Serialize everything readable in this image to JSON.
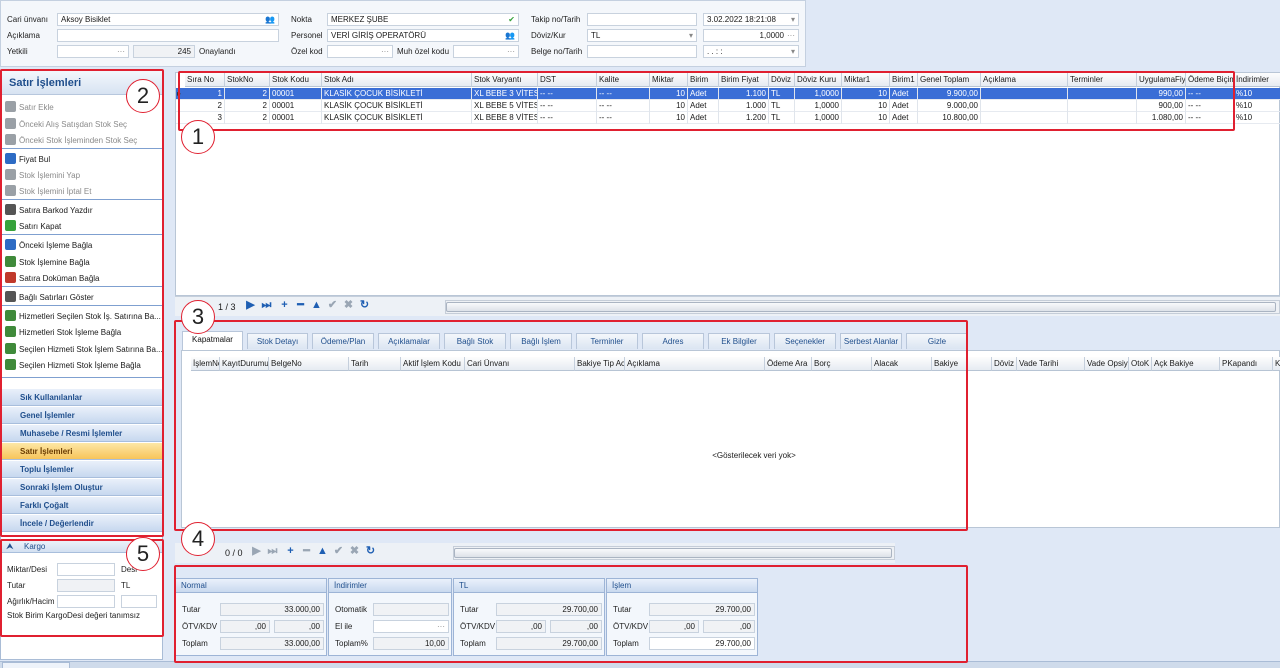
{
  "header": {
    "cari_unvani_label": "Cari ünvanı",
    "cari_unvani_value": "Aksoy Bisiklet",
    "aciklama_label": "Açıklama",
    "yetkili_label": "Yetkili",
    "yetkili_num": "245",
    "yetkili_status": "Onaylandı",
    "nokta_label": "Nokta",
    "nokta_value": "MERKEZ ŞUBE",
    "personel_label": "Personel",
    "personel_value": "VERİ GİRİŞ OPERATÖRÜ",
    "ozel_kod_label": "Özel kod",
    "muh_ozel_kodu_label": "Muh özel kodu",
    "takip_label": "Takip no/Tarih",
    "takip_date": "3.02.2022 18:21:08",
    "doviz_label": "Döviz/Kur",
    "doviz_value": "TL",
    "kur_value": "1,0000",
    "belge_label": "Belge no/Tarih",
    "belge_date": ". .  : :"
  },
  "left": {
    "title": "Satır İşlemleri",
    "items": [
      {
        "label": "Satır Ekle",
        "icon": "plus-icon",
        "color": "#9aa0a6"
      },
      {
        "label": "Önceki Alış Satışdan Stok Seç",
        "icon": "undo-icon",
        "color": "#9aa0a6"
      },
      {
        "label": "Önceki Stok İşleminden Stok Seç",
        "icon": "undo-icon",
        "color": "#9aa0a6"
      },
      {
        "label": "Fiyat Bul",
        "icon": "tag-icon",
        "color": "#2d6bc4"
      },
      {
        "label": "Stok İşlemini Yap",
        "icon": "redo-icon",
        "color": "#9aa0a6"
      },
      {
        "label": "Stok İşlemini İptal Et",
        "icon": "undo-icon",
        "color": "#9aa0a6"
      },
      {
        "label": "Satıra Barkod Yazdır",
        "icon": "barcode-icon",
        "color": "#555"
      },
      {
        "label": "Satırı Kapat",
        "icon": "check-circle-icon",
        "color": "#36a23b"
      },
      {
        "label": "Önceki İşleme Bağla",
        "icon": "eye-icon",
        "color": "#2d6bc4"
      },
      {
        "label": "Stok İşlemine Bağla",
        "icon": "gear-icon",
        "color": "#3f8a3a"
      },
      {
        "label": "Satıra Doküman Bağla",
        "icon": "document-icon",
        "color": "#c0392b"
      },
      {
        "label": "Bağlı Satırları Göster",
        "icon": "list-icon",
        "color": "#555"
      },
      {
        "label": "Hizmetleri Seçilen Stok İş. Satırına Ba...",
        "icon": "gear-icon",
        "color": "#3f8a3a"
      },
      {
        "label": "Hizmetleri Stok İşleme Bağla",
        "icon": "gear-icon",
        "color": "#3f8a3a"
      },
      {
        "label": "Seçilen Hizmeti Stok İşlem Satırına Ba...",
        "icon": "gear-icon",
        "color": "#3f8a3a"
      },
      {
        "label": "Seçilen Hizmeti Stok İşleme Bağla",
        "icon": "gear-icon",
        "color": "#3f8a3a"
      }
    ],
    "groups": [
      "Sık Kullanılanlar",
      "Genel İşlemler",
      "Muhasebe / Resmi İşlemler",
      "Satır İşlemleri",
      "Toplu İşlemler",
      "Sonraki İşlem Oluştur",
      "Farklı Çoğalt",
      "İncele / Değerlendir"
    ],
    "kargo": {
      "title": "Kargo",
      "miktar_label": "Miktar/Desi",
      "desi_label": "Desi",
      "tutar_label": "Tutar",
      "tutar_currency": "TL",
      "agirlik_label": "Ağırlık/Hacim",
      "note": "Stok Birim KargoDesi değeri tanımsız"
    }
  },
  "grid": {
    "columns": [
      "Sıra No",
      "StokNo",
      "Stok Kodu",
      "Stok Adı",
      "Stok Varyantı",
      "DST",
      "Kalite",
      "Miktar",
      "Birim",
      "Birim Fiyat",
      "Döviz",
      "Döviz Kuru",
      "Miktar1",
      "Birim1",
      "Genel Toplam",
      "Açıklama",
      "Terminler",
      "UygulamaFiy",
      "Ödeme Biçim",
      "İndirimler"
    ],
    "rows": [
      [
        "1",
        "2",
        "00001",
        "KLASİK ÇOCUK BİSİKLETİ",
        "XL BEBE 3 VİTES",
        "-- --",
        "-- --",
        "10",
        "Adet",
        "1.100",
        "TL",
        "1,0000",
        "10",
        "Adet",
        "9.900,00",
        "",
        "",
        "990,00",
        "-- --",
        "%10"
      ],
      [
        "2",
        "2",
        "00001",
        "KLASİK ÇOCUK BİSİKLETİ",
        "XL BEBE 5 VİTES",
        "-- --",
        "-- --",
        "10",
        "Adet",
        "1.000",
        "TL",
        "1,0000",
        "10",
        "Adet",
        "9.000,00",
        "",
        "",
        "900,00",
        "-- --",
        "%10"
      ],
      [
        "3",
        "2",
        "00001",
        "KLASİK ÇOCUK BİSİKLETİ",
        "XL BEBE 8 VİTES",
        "-- --",
        "-- --",
        "10",
        "Adet",
        "1.200",
        "TL",
        "1,0000",
        "10",
        "Adet",
        "10.800,00",
        "",
        "",
        "1.080,00",
        "-- --",
        "%10"
      ]
    ],
    "record_nav": "1 / 3"
  },
  "tabs": [
    "Kapatmalar",
    "Stok Detayı",
    "Ödeme/Plan",
    "Açıklamalar",
    "Bağlı Stok",
    "Bağlı İşlem",
    "Terminler",
    "Adres",
    "Ek Bilgiler",
    "Seçenekler",
    "Serbest Alanlar",
    "Gizle"
  ],
  "subgrid": {
    "columns": [
      "İşlemNo",
      "KayıtDurumu",
      "BelgeNo",
      "Tarih",
      "Aktif İşlem Kodu",
      "Cari Ünvanı",
      "Bakiye Tip Ac",
      "Açıklama",
      "Ödeme Ara",
      "Borç",
      "Alacak",
      "Bakiye",
      "Döviz",
      "Vade Tarihi",
      "Vade Opsiy",
      "OtoK",
      "Açk Bakiye",
      "PKapandı",
      "Ka"
    ],
    "empty_text": "<Gösterilecek veri yok>",
    "record_nav": "0 / 0"
  },
  "totals": {
    "normal": {
      "title": "Normal",
      "tutar_label": "Tutar",
      "tutar": "33.000,00",
      "otv_label": "ÖTV/KDV",
      "otv1": ",00",
      "otv2": ",00",
      "toplam_label": "Toplam",
      "toplam": "33.000,00"
    },
    "indirimler": {
      "title": "İndirimler",
      "otomatik_label": "Otomatik",
      "elile_label": "El ile",
      "toplam_label": "Toplam%",
      "toplam": "10,00"
    },
    "tl": {
      "title": "TL",
      "tutar_label": "Tutar",
      "tutar": "29.700,00",
      "otv_label": "ÖTV/KDV",
      "otv1": ",00",
      "otv2": ",00",
      "toplam_label": "Toplam",
      "toplam": "29.700,00"
    },
    "islem": {
      "title": "İşlem",
      "tutar_label": "Tutar",
      "tutar": "29.700,00",
      "otv_label": "ÖTV/KDV",
      "otv1": ",00",
      "otv2": ",00",
      "toplam_label": "Toplam",
      "toplam": "29.700,00"
    }
  },
  "callouts": [
    "1",
    "2",
    "3",
    "4",
    "5"
  ],
  "colors": {
    "selection": "#3a6ed6",
    "highlight": "#e02030",
    "accent": "#1f4e8c"
  }
}
